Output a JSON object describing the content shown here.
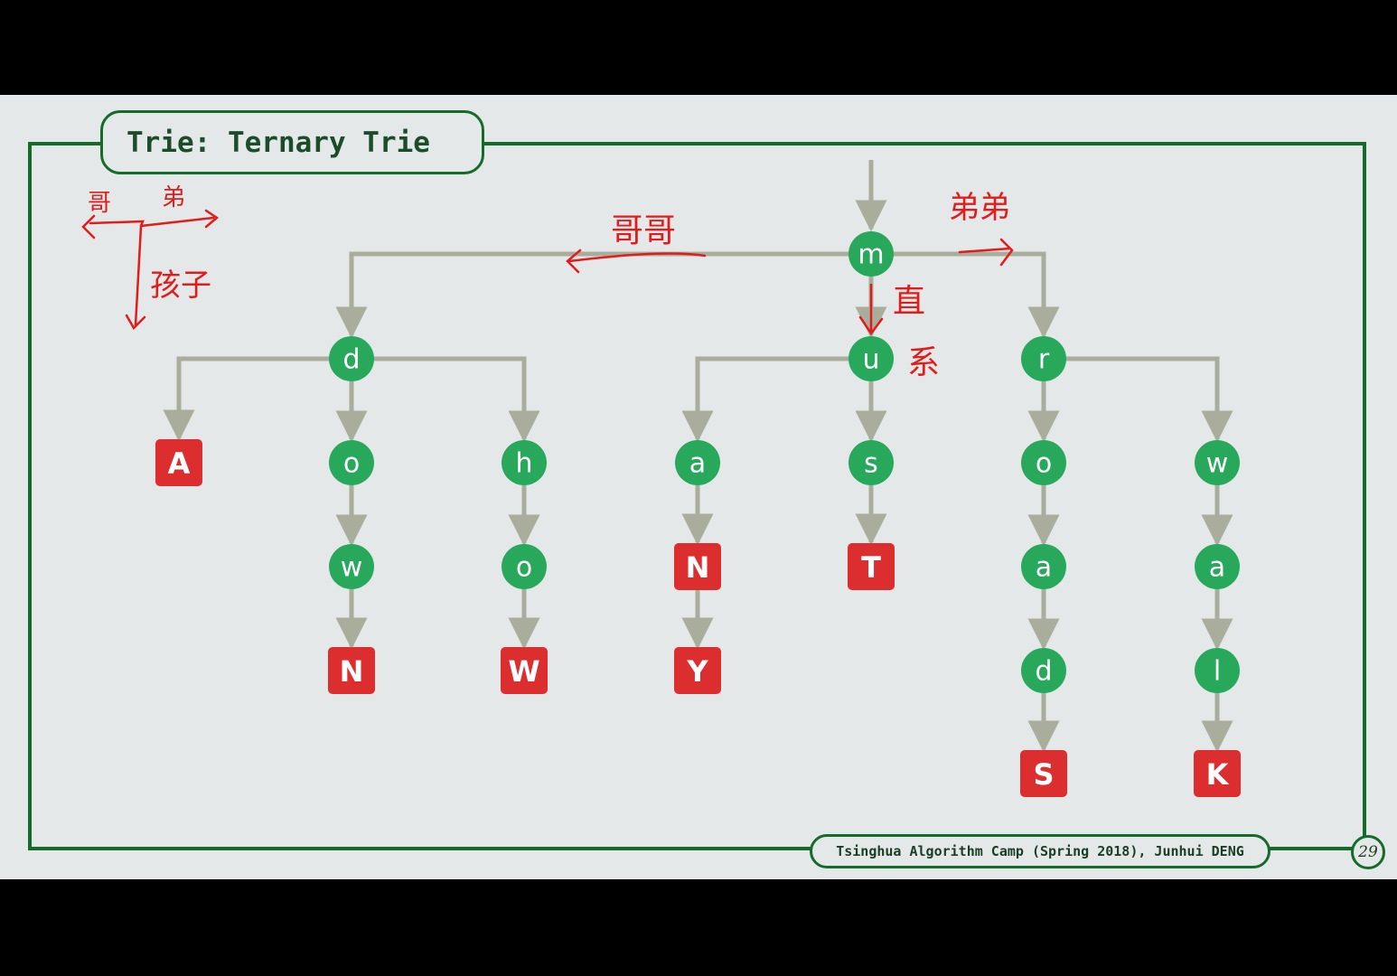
{
  "slide": {
    "title": "Trie: Ternary Trie",
    "footer": "Tsinghua Algorithm Camp (Spring 2018), Junhui DENG",
    "page_number": "29"
  },
  "colors": {
    "frame": "#156b2a",
    "internal_node": "#27a85a",
    "terminal_node": "#dc2e2e",
    "edge": "#a9ae9c",
    "annotation": "#e21b1b",
    "background": "#e4e8e8"
  },
  "tree": {
    "root_id": "m",
    "nodes": [
      {
        "id": "m",
        "label": "m",
        "kind": "internal"
      },
      {
        "id": "d",
        "label": "d",
        "kind": "internal"
      },
      {
        "id": "u",
        "label": "u",
        "kind": "internal"
      },
      {
        "id": "r",
        "label": "r",
        "kind": "internal"
      },
      {
        "id": "A",
        "label": "A",
        "kind": "terminal"
      },
      {
        "id": "o1",
        "label": "o",
        "kind": "internal"
      },
      {
        "id": "h",
        "label": "h",
        "kind": "internal"
      },
      {
        "id": "w1",
        "label": "w",
        "kind": "internal"
      },
      {
        "id": "N1",
        "label": "N",
        "kind": "terminal"
      },
      {
        "id": "o2",
        "label": "o",
        "kind": "internal"
      },
      {
        "id": "W",
        "label": "W",
        "kind": "terminal"
      },
      {
        "id": "a1",
        "label": "a",
        "kind": "internal"
      },
      {
        "id": "N2",
        "label": "N",
        "kind": "terminal"
      },
      {
        "id": "Y",
        "label": "Y",
        "kind": "terminal"
      },
      {
        "id": "s",
        "label": "s",
        "kind": "internal"
      },
      {
        "id": "T",
        "label": "T",
        "kind": "terminal"
      },
      {
        "id": "o3",
        "label": "o",
        "kind": "internal"
      },
      {
        "id": "a2",
        "label": "a",
        "kind": "internal"
      },
      {
        "id": "d2",
        "label": "d",
        "kind": "internal"
      },
      {
        "id": "S",
        "label": "S",
        "kind": "terminal"
      },
      {
        "id": "w2",
        "label": "w",
        "kind": "internal"
      },
      {
        "id": "a3",
        "label": "a",
        "kind": "internal"
      },
      {
        "id": "l",
        "label": "l",
        "kind": "internal"
      },
      {
        "id": "K",
        "label": "K",
        "kind": "terminal"
      }
    ],
    "edges": [
      {
        "from": "m",
        "to": "d",
        "type": "left"
      },
      {
        "from": "m",
        "to": "u",
        "type": "middle"
      },
      {
        "from": "m",
        "to": "r",
        "type": "right"
      },
      {
        "from": "d",
        "to": "A",
        "type": "left"
      },
      {
        "from": "d",
        "to": "o1",
        "type": "middle"
      },
      {
        "from": "d",
        "to": "h",
        "type": "right"
      },
      {
        "from": "o1",
        "to": "w1",
        "type": "middle"
      },
      {
        "from": "w1",
        "to": "N1",
        "type": "middle"
      },
      {
        "from": "h",
        "to": "o2",
        "type": "middle"
      },
      {
        "from": "o2",
        "to": "W",
        "type": "middle"
      },
      {
        "from": "u",
        "to": "a1",
        "type": "left"
      },
      {
        "from": "u",
        "to": "s",
        "type": "middle"
      },
      {
        "from": "a1",
        "to": "N2",
        "type": "middle"
      },
      {
        "from": "N2",
        "to": "Y",
        "type": "middle"
      },
      {
        "from": "s",
        "to": "T",
        "type": "middle"
      },
      {
        "from": "r",
        "to": "o3",
        "type": "middle"
      },
      {
        "from": "r",
        "to": "w2",
        "type": "right"
      },
      {
        "from": "o3",
        "to": "a2",
        "type": "middle"
      },
      {
        "from": "a2",
        "to": "d2",
        "type": "middle"
      },
      {
        "from": "d2",
        "to": "S",
        "type": "middle"
      },
      {
        "from": "w2",
        "to": "a3",
        "type": "middle"
      },
      {
        "from": "a3",
        "to": "l",
        "type": "middle"
      },
      {
        "from": "l",
        "to": "K",
        "type": "middle"
      }
    ]
  },
  "annotations": {
    "legend_older": "哥",
    "legend_younger": "弟",
    "legend_child": "孩子",
    "left_older_siblings": "哥哥",
    "right_younger_siblings": "弟弟",
    "direct_child_1": "直",
    "direct_child_2": "系"
  }
}
